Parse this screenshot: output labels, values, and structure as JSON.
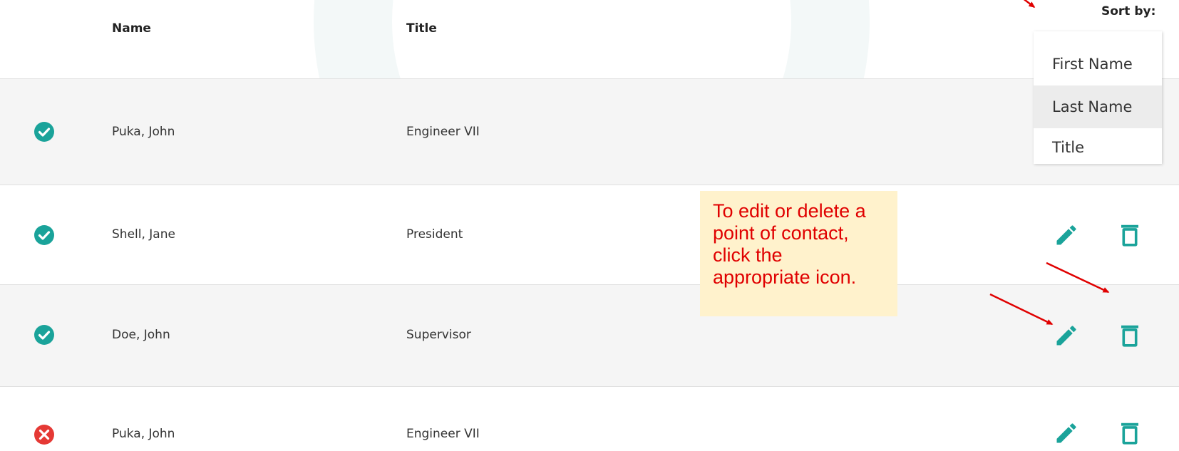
{
  "header": {
    "name_label": "Name",
    "title_label": "Title"
  },
  "sort": {
    "label": "Sort by:",
    "options": [
      "First Name",
      "Last Name",
      "Title"
    ],
    "selected": "Last Name"
  },
  "rows": [
    {
      "status": "active",
      "name": "Puka, John",
      "title": "Engineer VII",
      "actions_visible": false
    },
    {
      "status": "active",
      "name": "Shell, Jane",
      "title": "President",
      "actions_visible": true
    },
    {
      "status": "active",
      "name": "Doe, John",
      "title": "Supervisor",
      "actions_visible": true
    },
    {
      "status": "inactive",
      "name": "Puka, John",
      "title": "Engineer VII",
      "actions_visible": true
    }
  ],
  "callout": {
    "text": "To edit or delete a point of contact, click the appropriate icon."
  },
  "icons": {
    "status_active": "check-circle-icon",
    "status_inactive": "x-circle-icon",
    "edit": "pencil-icon",
    "delete": "trash-icon"
  },
  "colors": {
    "accent": "#1aa39a",
    "error": "#e53935",
    "annotation": "#e00000",
    "callout_bg": "#fff2cc",
    "row_shade": "#f5f5f5"
  }
}
